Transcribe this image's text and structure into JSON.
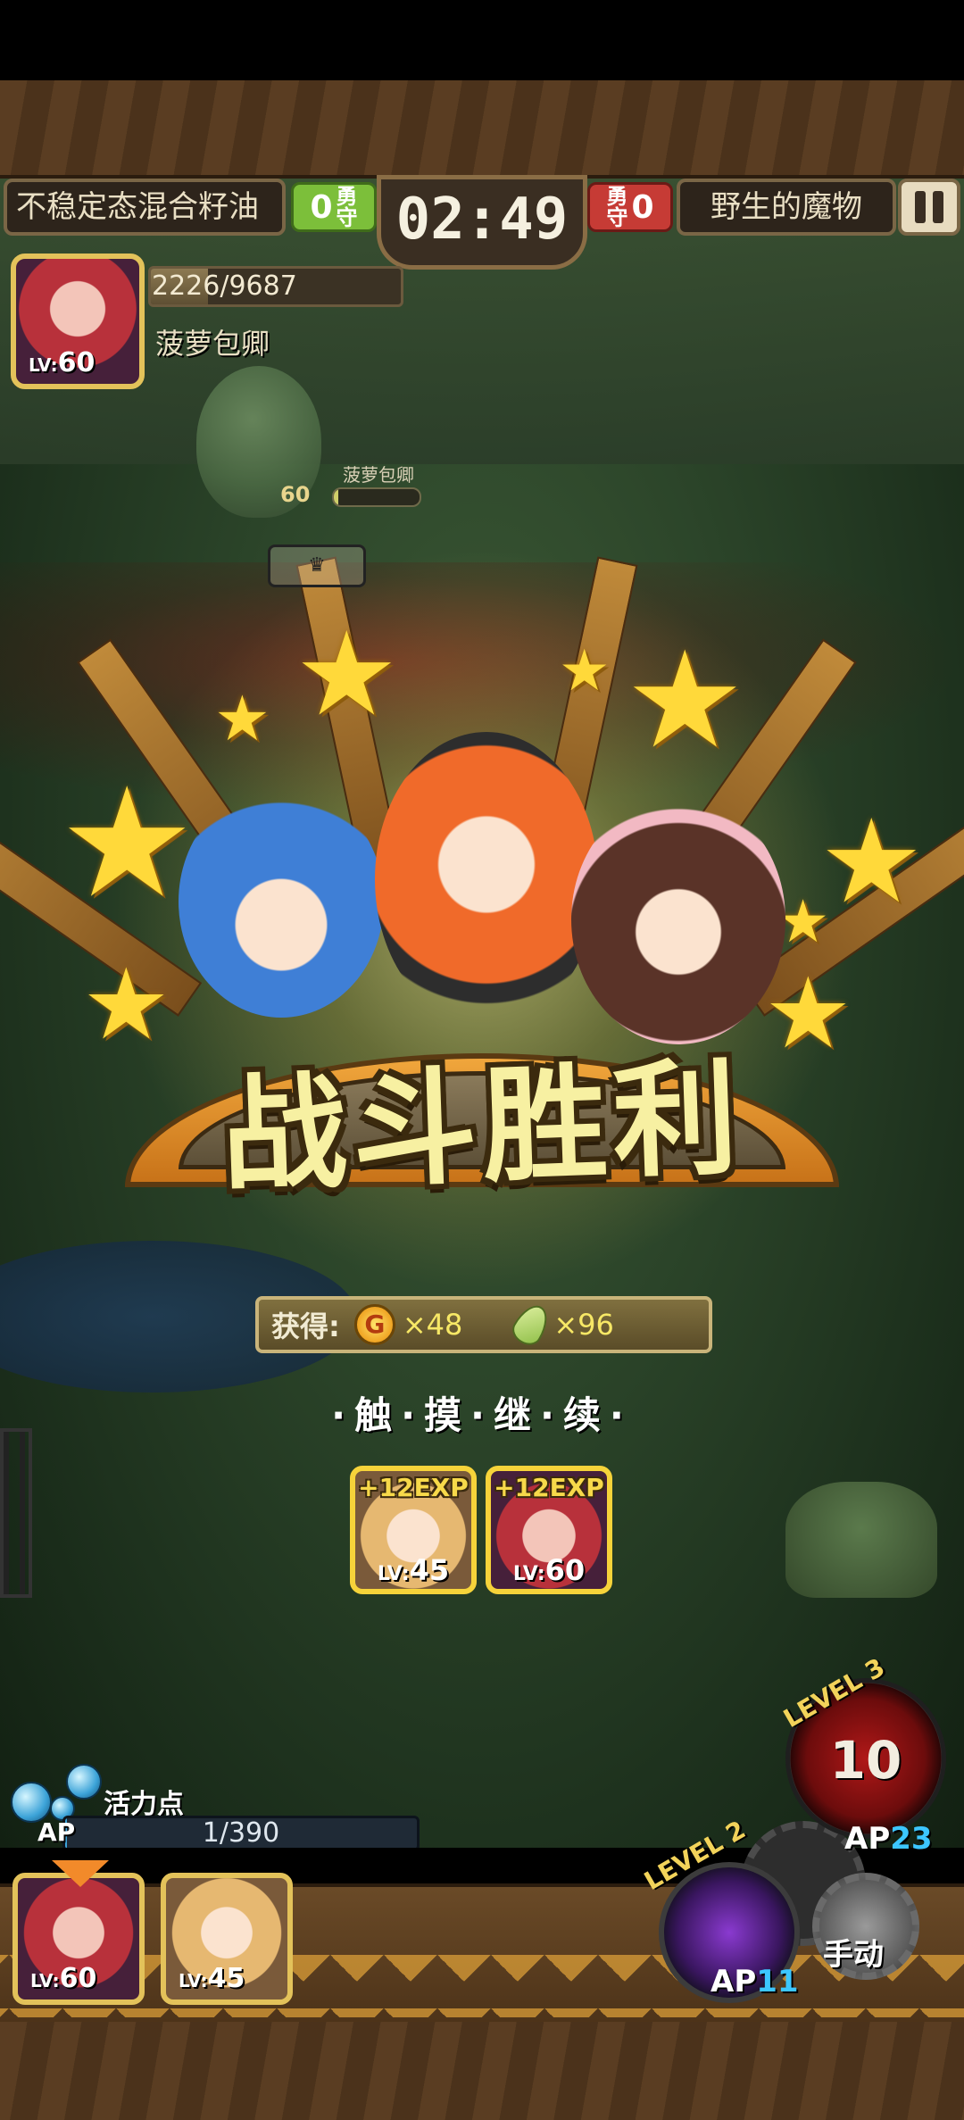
{
  "hud": {
    "left_team": "不稳定态混合籽油",
    "left_score": "0",
    "left_score_label": "勇\n守",
    "timer": "02:49",
    "right_score": "0",
    "right_score_label": "勇\n守",
    "right_team": "野生的魔物"
  },
  "leader": {
    "hp_text": "2226/9687",
    "hp_fraction": 0.23,
    "name": "菠萝包卿",
    "lv_label": "LV:",
    "lv": "60"
  },
  "enemy": {
    "tag": "菠萝包卿",
    "lv": "60",
    "hp_fraction": 0.05
  },
  "victory": {
    "title": "战斗胜利",
    "reward_label": "获得:",
    "coin_symbol": "G",
    "coin_amount": "×48",
    "feather_amount": "×96",
    "touch_continue": "·触·摸·继·续·"
  },
  "exp_cards": [
    {
      "exp": "+12EXP",
      "lv_label": "LV:",
      "lv": "45"
    },
    {
      "exp": "+12EXP",
      "lv_label": "LV:",
      "lv": "60"
    }
  ],
  "ap": {
    "label": "活力点",
    "tag": "AP",
    "text": "1/390",
    "fraction": 0.003
  },
  "party": [
    {
      "lv_label": "LV:",
      "lv": "60"
    },
    {
      "lv_label": "LV:",
      "lv": "45"
    }
  ],
  "skills": {
    "level3_label": "LEVEL 3",
    "level3_count": "10",
    "level3_ap_prefix": "AP",
    "level3_ap": "23",
    "level2_label": "LEVEL 2",
    "level2_ap_prefix": "AP",
    "level2_ap": "11",
    "manual": "手动"
  },
  "colors": {
    "gold": "#f6d33a",
    "score_green": "#7cbf3a",
    "score_red": "#c63b35",
    "ap_blue": "#3ca3d8"
  }
}
